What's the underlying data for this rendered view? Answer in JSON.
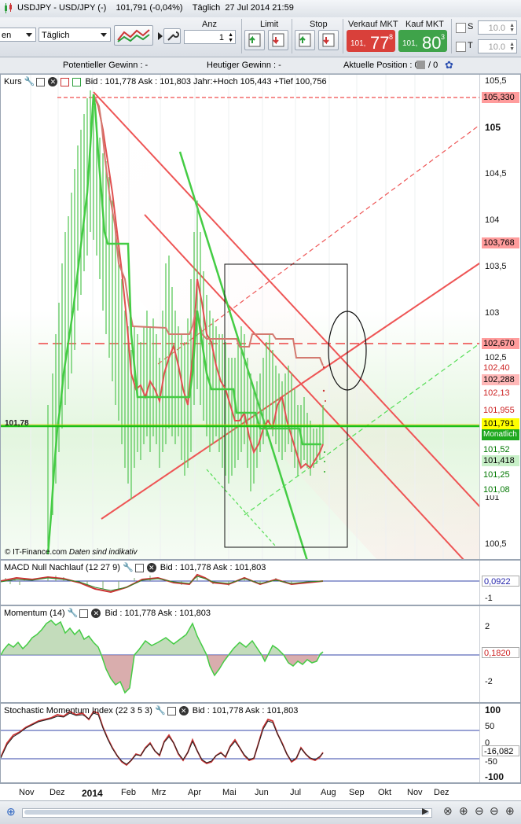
{
  "window": {
    "title": "USDJPY - USD/JPY (-)",
    "price": "101,791 (-0,04%)",
    "period": "Täglich",
    "datetime": "27 Jul 2014 21:59"
  },
  "toolbar": {
    "left_select": "en",
    "period_select": "Täglich",
    "anz_label": "Anz",
    "anz_value": "1",
    "limit_label": "Limit",
    "stop_label": "Stop",
    "sell_label": "Verkauf MKT",
    "sell_small": "101,",
    "sell_big": "77",
    "sell_sup": "8",
    "buy_label": "Kauf MKT",
    "buy_small": "101,",
    "buy_big": "80",
    "buy_sup": "3",
    "s_label": "S",
    "t_label": "T",
    "s_value": "10.0",
    "t_value": "10.0",
    "colors": {
      "sell": "#d9403a",
      "buy": "#3fa34a"
    }
  },
  "infobar": {
    "potential": "Potentieller Gewinn : -",
    "today": "Heutiger Gewinn : -",
    "position": "Aktuelle Position : 0"
  },
  "main_panel": {
    "title": "Kurs",
    "header": "Bid : 101,778 Ask : 101,803 Jahr:+Hoch 105,443 +Tief 100,756",
    "left_price": "101,78",
    "watermark": "© IT-Finance.com",
    "disclaimer": "Daten sind indikativ",
    "y_labels": [
      "105,5",
      "105",
      "104,5",
      "104",
      "103,5",
      "103",
      "102,5",
      "101",
      "100,5"
    ],
    "price_tags": [
      {
        "text": "105,330",
        "bg": "#ff9c9c",
        "fg": "#000"
      },
      {
        "text": "103,768",
        "bg": "#ff9c9c",
        "fg": "#000"
      },
      {
        "text": "102,670",
        "bg": "#ff9c9c",
        "fg": "#000"
      },
      {
        "text": "102,40",
        "bg": "#fff",
        "fg": "#c22"
      },
      {
        "text": "102,288",
        "bg": "#ffb8b8",
        "fg": "#000"
      },
      {
        "text": "102,13",
        "bg": "#fff",
        "fg": "#c22"
      },
      {
        "text": "101,955",
        "bg": "#fff",
        "fg": "#c22"
      },
      {
        "text": "101,791",
        "bg": "#ffff00",
        "fg": "#000"
      },
      {
        "text": "Monatlich",
        "bg": "#1ea81e",
        "fg": "#fff"
      },
      {
        "text": "101,52",
        "bg": "#fff",
        "fg": "#070"
      },
      {
        "text": "101,418",
        "bg": "#c8f0c8",
        "fg": "#000"
      },
      {
        "text": "101,25",
        "bg": "#fff",
        "fg": "#070"
      },
      {
        "text": "101,08",
        "bg": "#fff",
        "fg": "#070"
      }
    ]
  },
  "macd_panel": {
    "title": "MACD Null Nachlauf (12 27 9)",
    "header": "Bid : 101,778 Ask : 101,803",
    "value": "0,0922",
    "y_labels": [
      "-1"
    ]
  },
  "momentum_panel": {
    "title": "Momentum (14)",
    "header": "Bid : 101,778 Ask : 101,803",
    "value": "0,1820",
    "y_labels": [
      "2",
      "0",
      "-2"
    ]
  },
  "stoch_panel": {
    "title": "Stochastic Momentum Index (22 3 5 3)",
    "header": "Bid : 101,778 Ask : 101,803",
    "value": "-16,082",
    "y_labels": [
      "100",
      "50",
      "0",
      "-50",
      "-100"
    ]
  },
  "xaxis": {
    "labels": [
      "Nov",
      "Dez",
      "2014",
      "Feb",
      "Mrz",
      "Apr",
      "Mai",
      "Jun",
      "Jul",
      "Aug",
      "Sep",
      "Okt",
      "Nov",
      "Dez"
    ]
  }
}
